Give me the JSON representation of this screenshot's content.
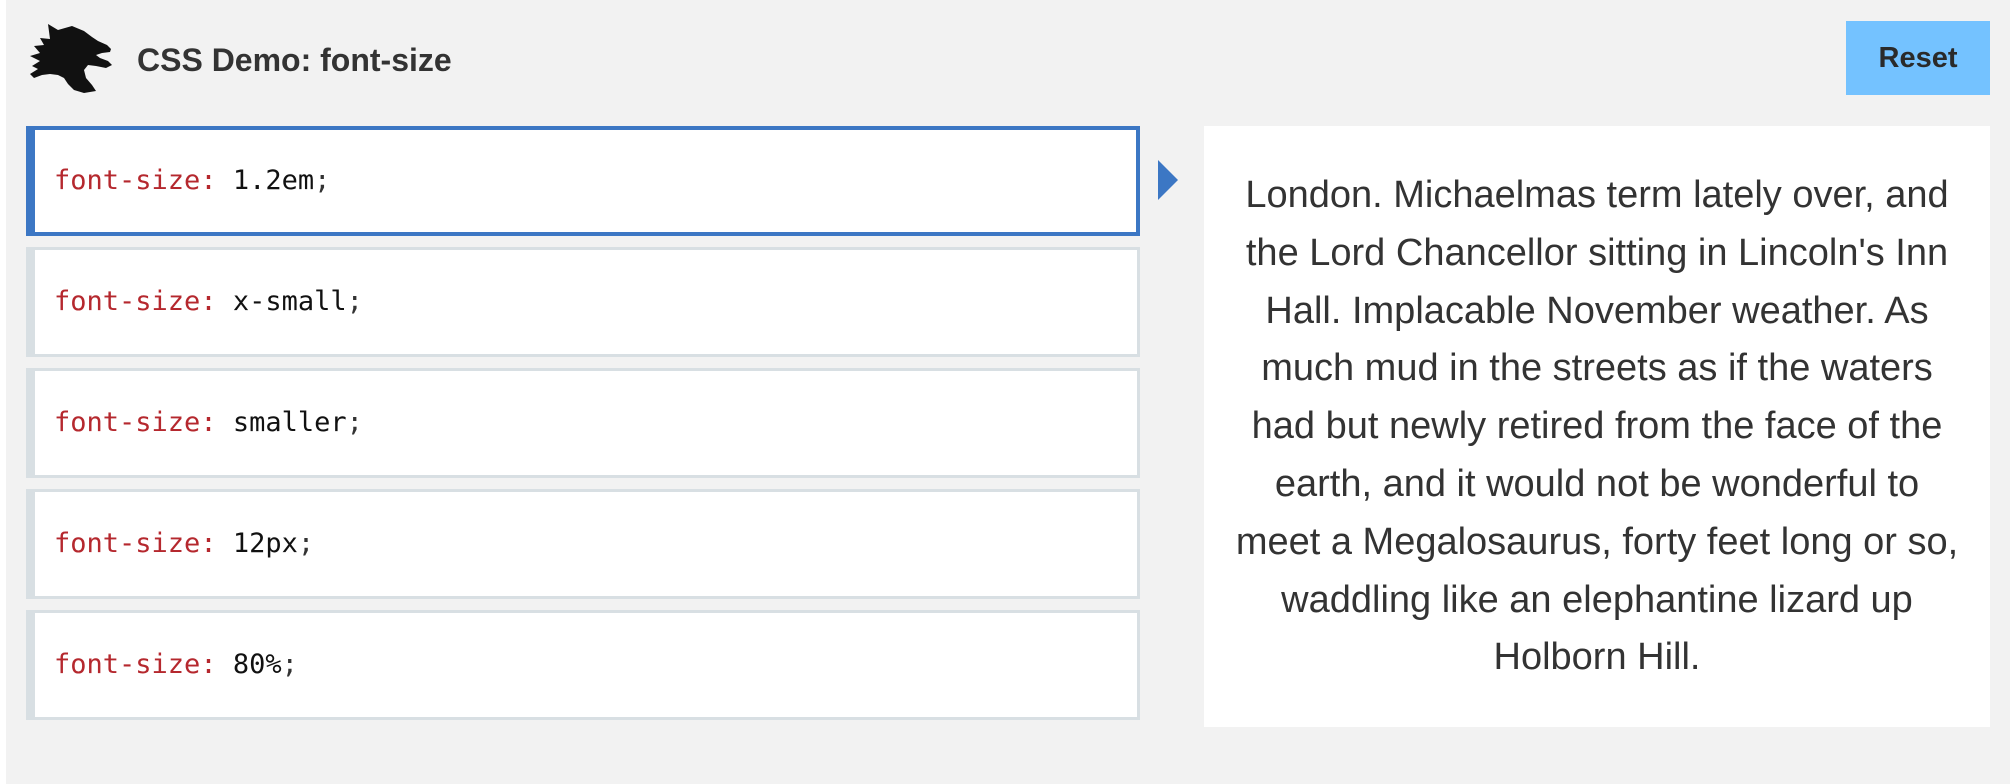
{
  "header": {
    "title": "CSS Demo: font-size",
    "reset_label": "Reset",
    "logo_icon": "dinosaur-logo-icon"
  },
  "options": [
    {
      "property": "font-size",
      "value": "1.2em",
      "selected": true
    },
    {
      "property": "font-size",
      "value": "x-small",
      "selected": false
    },
    {
      "property": "font-size",
      "value": "smaller",
      "selected": false
    },
    {
      "property": "font-size",
      "value": "12px",
      "selected": false
    },
    {
      "property": "font-size",
      "value": "80%",
      "selected": false
    }
  ],
  "output": {
    "text": "London. Michaelmas term lately over, and the Lord Chancellor sitting in Lincoln's Inn Hall. Implacable November weather. As much mud in the streets as if the waters had but newly retired from the face of the earth, and it would not be wonderful to meet a Megalosaurus, forty feet long or so, waddling like an elephantine lizard up Holborn Hill."
  },
  "colors": {
    "accent": "#3c77c4",
    "reset_button": "#74c2ff",
    "property_text": "#b5282e",
    "background": "#f2f2f2"
  }
}
